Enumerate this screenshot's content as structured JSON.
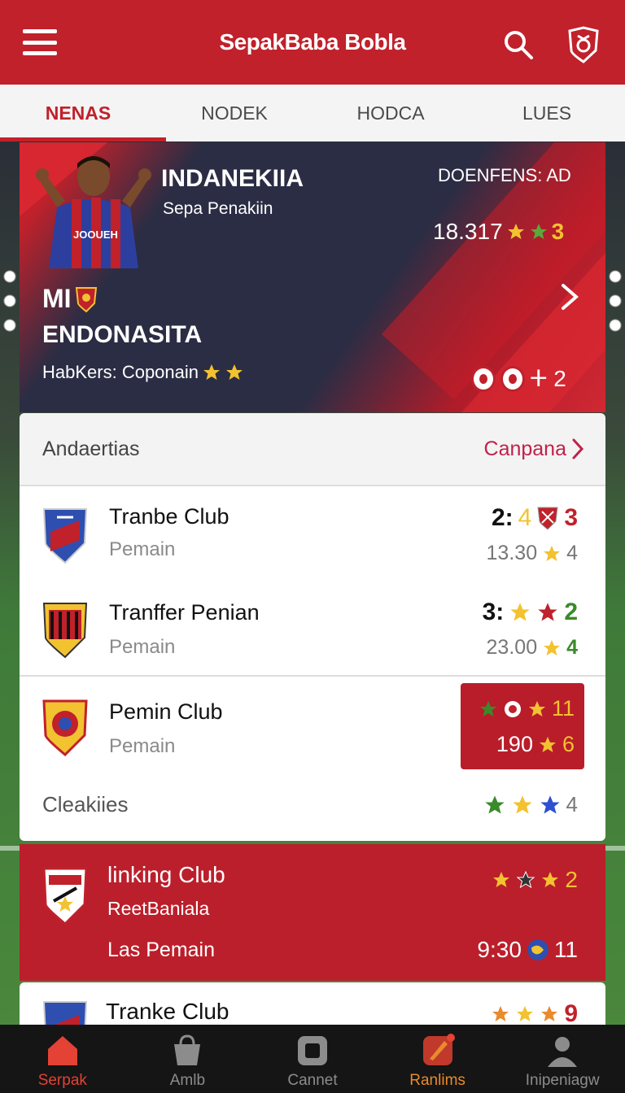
{
  "header": {
    "title": "SepakBaba Bobla"
  },
  "tabs": [
    {
      "label": "NENAS",
      "active": true
    },
    {
      "label": "NODEK"
    },
    {
      "label": "HODCA"
    },
    {
      "label": "LUES"
    }
  ],
  "hero": {
    "player_name": "INDANEKIIA",
    "player_sub": "Sepa Penakiin",
    "shirt_text": "JOOUEH",
    "label_right": "DOENFENS: AD",
    "score": "18.317",
    "score_count": "3",
    "title_line1": "MI",
    "title_line2": "ENDONASITA",
    "desc": "HabKers: Coponain",
    "badge_count": "ⵜ 2"
  },
  "section": {
    "title": "Andaertias",
    "link": "Canpana"
  },
  "rows": [
    {
      "name": "Tranbe Club",
      "sub": "Pemain",
      "score_a": "2:",
      "score_a2": "4",
      "score_a3": "3",
      "score_b": "13.30",
      "score_b2": "4"
    },
    {
      "name": "Tranffer Penian",
      "sub": "Pemain",
      "score_a": "3:",
      "score_a3": "2",
      "score_b": "23.00",
      "score_b2": "4"
    },
    {
      "name": "Pemin Club",
      "sub": "Pemain",
      "hl_1": "11",
      "hl_2a": "190",
      "hl_2b": "6"
    }
  ],
  "footer_row": {
    "label": "Cleakiies",
    "count": "4"
  },
  "red_card": {
    "name": "linking Club",
    "sub": "ReetBaniala",
    "desc": "Las Pemain",
    "star_count": "2",
    "time": "9:30",
    "time_count": "11"
  },
  "partial_card": {
    "name": "Tranke Club",
    "count": "9"
  },
  "nav": [
    {
      "label": "Serpak",
      "icon": "home-icon"
    },
    {
      "label": "Amlb",
      "icon": "shop-icon"
    },
    {
      "label": "Cannet",
      "icon": "camera-icon"
    },
    {
      "label": "Ranlims",
      "icon": "rocket-icon"
    },
    {
      "label": "Inipeniagw",
      "icon": "profile-icon"
    }
  ],
  "colors": {
    "primary": "#c0212b",
    "dark": "#2a2d44",
    "gold": "#f2c230",
    "nav_bg": "#151515"
  }
}
